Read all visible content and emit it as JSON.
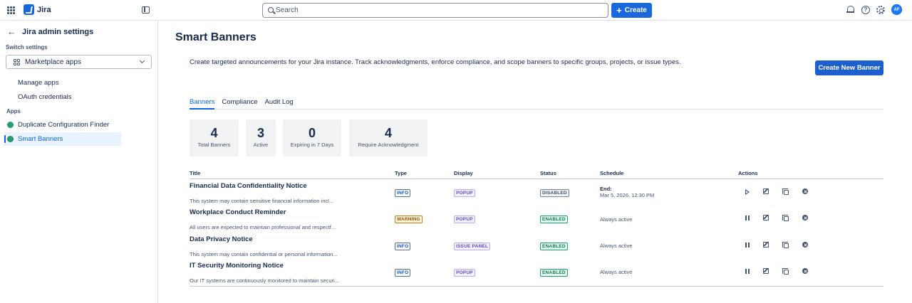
{
  "topbar": {
    "app_name": "Jira",
    "search_placeholder": "Search",
    "create_label": "Create",
    "avatar_initials": "AF"
  },
  "sidebar": {
    "back_title": "Jira admin settings",
    "switch_label": "Switch settings",
    "switch_value": "Marketplace apps",
    "nav": [
      "Manage apps",
      "OAuth credentials"
    ],
    "apps_label": "Apps",
    "apps": [
      "Duplicate Configuration Finder",
      "Smart Banners"
    ]
  },
  "main": {
    "title": "Smart Banners",
    "description": "Create targeted announcements for your Jira instance. Track acknowledgments, enforce compliance, and scope banners to specific groups, projects, or issue types.",
    "new_button": "Create New Banner",
    "tabs": [
      "Banners",
      "Compliance",
      "Audit Log"
    ],
    "stats": [
      {
        "value": "4",
        "label": "Total Banners"
      },
      {
        "value": "3",
        "label": "Active"
      },
      {
        "value": "0",
        "label": "Expiring in 7 Days"
      },
      {
        "value": "4",
        "label": "Require Acknowledgment"
      }
    ],
    "columns": {
      "title": "Title",
      "type": "Type",
      "display": "Display",
      "status": "Status",
      "schedule": "Schedule",
      "actions": "Actions"
    },
    "rows": [
      {
        "title": "Financial Data Confidentiality Notice",
        "desc": "This system may contain sensitive financial information incl...",
        "type": "INFO",
        "display": "POPUP",
        "status": "DISABLED",
        "schedule_label": "End:",
        "schedule": "Mar 5, 2026, 12:30 PM"
      },
      {
        "title": "Workplace Conduct Reminder",
        "desc": "All users are expected to maintain professional and respectf...",
        "type": "WARNING",
        "display": "POPUP",
        "status": "ENABLED",
        "schedule": "Always active"
      },
      {
        "title": "Data Privacy Notice",
        "desc": "This system may contain confidential or personal information...",
        "type": "INFO",
        "display": "ISSUE PANEL",
        "status": "ENABLED",
        "schedule": "Always active"
      },
      {
        "title": "IT Security Monitoring Notice",
        "desc": "Our IT systems are continuously monitored to maintain securi...",
        "type": "INFO",
        "display": "POPUP",
        "status": "ENABLED",
        "schedule": "Always active"
      }
    ]
  }
}
